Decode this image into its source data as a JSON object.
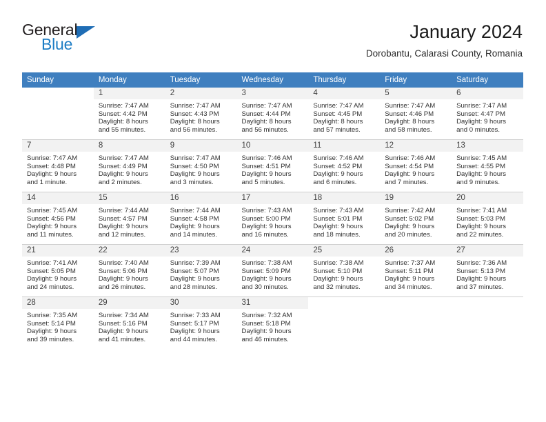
{
  "brand": {
    "name_part1": "General",
    "name_part2": "Blue",
    "logo_icon": "triangle-logo-icon"
  },
  "header": {
    "month_title": "January 2024",
    "location": "Dorobantu, Calarasi County, Romania"
  },
  "colors": {
    "header_blue": "#3f7fbf",
    "brand_blue": "#1c7cc4",
    "daynum_bg": "#f2f2f2",
    "grid_line": "#cfcfcf"
  },
  "weekday_headers": [
    "Sunday",
    "Monday",
    "Tuesday",
    "Wednesday",
    "Thursday",
    "Friday",
    "Saturday"
  ],
  "weeks": [
    [
      {
        "day": "",
        "blank": true,
        "sunrise": "",
        "sunset": "",
        "daylight_line1": "",
        "daylight_line2": ""
      },
      {
        "day": "1",
        "sunrise": "Sunrise: 7:47 AM",
        "sunset": "Sunset: 4:42 PM",
        "daylight_line1": "Daylight: 8 hours",
        "daylight_line2": "and 55 minutes."
      },
      {
        "day": "2",
        "sunrise": "Sunrise: 7:47 AM",
        "sunset": "Sunset: 4:43 PM",
        "daylight_line1": "Daylight: 8 hours",
        "daylight_line2": "and 56 minutes."
      },
      {
        "day": "3",
        "sunrise": "Sunrise: 7:47 AM",
        "sunset": "Sunset: 4:44 PM",
        "daylight_line1": "Daylight: 8 hours",
        "daylight_line2": "and 56 minutes."
      },
      {
        "day": "4",
        "sunrise": "Sunrise: 7:47 AM",
        "sunset": "Sunset: 4:45 PM",
        "daylight_line1": "Daylight: 8 hours",
        "daylight_line2": "and 57 minutes."
      },
      {
        "day": "5",
        "sunrise": "Sunrise: 7:47 AM",
        "sunset": "Sunset: 4:46 PM",
        "daylight_line1": "Daylight: 8 hours",
        "daylight_line2": "and 58 minutes."
      },
      {
        "day": "6",
        "sunrise": "Sunrise: 7:47 AM",
        "sunset": "Sunset: 4:47 PM",
        "daylight_line1": "Daylight: 9 hours",
        "daylight_line2": "and 0 minutes."
      }
    ],
    [
      {
        "day": "7",
        "sunrise": "Sunrise: 7:47 AM",
        "sunset": "Sunset: 4:48 PM",
        "daylight_line1": "Daylight: 9 hours",
        "daylight_line2": "and 1 minute."
      },
      {
        "day": "8",
        "sunrise": "Sunrise: 7:47 AM",
        "sunset": "Sunset: 4:49 PM",
        "daylight_line1": "Daylight: 9 hours",
        "daylight_line2": "and 2 minutes."
      },
      {
        "day": "9",
        "sunrise": "Sunrise: 7:47 AM",
        "sunset": "Sunset: 4:50 PM",
        "daylight_line1": "Daylight: 9 hours",
        "daylight_line2": "and 3 minutes."
      },
      {
        "day": "10",
        "sunrise": "Sunrise: 7:46 AM",
        "sunset": "Sunset: 4:51 PM",
        "daylight_line1": "Daylight: 9 hours",
        "daylight_line2": "and 5 minutes."
      },
      {
        "day": "11",
        "sunrise": "Sunrise: 7:46 AM",
        "sunset": "Sunset: 4:52 PM",
        "daylight_line1": "Daylight: 9 hours",
        "daylight_line2": "and 6 minutes."
      },
      {
        "day": "12",
        "sunrise": "Sunrise: 7:46 AM",
        "sunset": "Sunset: 4:54 PM",
        "daylight_line1": "Daylight: 9 hours",
        "daylight_line2": "and 7 minutes."
      },
      {
        "day": "13",
        "sunrise": "Sunrise: 7:45 AM",
        "sunset": "Sunset: 4:55 PM",
        "daylight_line1": "Daylight: 9 hours",
        "daylight_line2": "and 9 minutes."
      }
    ],
    [
      {
        "day": "14",
        "sunrise": "Sunrise: 7:45 AM",
        "sunset": "Sunset: 4:56 PM",
        "daylight_line1": "Daylight: 9 hours",
        "daylight_line2": "and 11 minutes."
      },
      {
        "day": "15",
        "sunrise": "Sunrise: 7:44 AM",
        "sunset": "Sunset: 4:57 PM",
        "daylight_line1": "Daylight: 9 hours",
        "daylight_line2": "and 12 minutes."
      },
      {
        "day": "16",
        "sunrise": "Sunrise: 7:44 AM",
        "sunset": "Sunset: 4:58 PM",
        "daylight_line1": "Daylight: 9 hours",
        "daylight_line2": "and 14 minutes."
      },
      {
        "day": "17",
        "sunrise": "Sunrise: 7:43 AM",
        "sunset": "Sunset: 5:00 PM",
        "daylight_line1": "Daylight: 9 hours",
        "daylight_line2": "and 16 minutes."
      },
      {
        "day": "18",
        "sunrise": "Sunrise: 7:43 AM",
        "sunset": "Sunset: 5:01 PM",
        "daylight_line1": "Daylight: 9 hours",
        "daylight_line2": "and 18 minutes."
      },
      {
        "day": "19",
        "sunrise": "Sunrise: 7:42 AM",
        "sunset": "Sunset: 5:02 PM",
        "daylight_line1": "Daylight: 9 hours",
        "daylight_line2": "and 20 minutes."
      },
      {
        "day": "20",
        "sunrise": "Sunrise: 7:41 AM",
        "sunset": "Sunset: 5:03 PM",
        "daylight_line1": "Daylight: 9 hours",
        "daylight_line2": "and 22 minutes."
      }
    ],
    [
      {
        "day": "21",
        "sunrise": "Sunrise: 7:41 AM",
        "sunset": "Sunset: 5:05 PM",
        "daylight_line1": "Daylight: 9 hours",
        "daylight_line2": "and 24 minutes."
      },
      {
        "day": "22",
        "sunrise": "Sunrise: 7:40 AM",
        "sunset": "Sunset: 5:06 PM",
        "daylight_line1": "Daylight: 9 hours",
        "daylight_line2": "and 26 minutes."
      },
      {
        "day": "23",
        "sunrise": "Sunrise: 7:39 AM",
        "sunset": "Sunset: 5:07 PM",
        "daylight_line1": "Daylight: 9 hours",
        "daylight_line2": "and 28 minutes."
      },
      {
        "day": "24",
        "sunrise": "Sunrise: 7:38 AM",
        "sunset": "Sunset: 5:09 PM",
        "daylight_line1": "Daylight: 9 hours",
        "daylight_line2": "and 30 minutes."
      },
      {
        "day": "25",
        "sunrise": "Sunrise: 7:38 AM",
        "sunset": "Sunset: 5:10 PM",
        "daylight_line1": "Daylight: 9 hours",
        "daylight_line2": "and 32 minutes."
      },
      {
        "day": "26",
        "sunrise": "Sunrise: 7:37 AM",
        "sunset": "Sunset: 5:11 PM",
        "daylight_line1": "Daylight: 9 hours",
        "daylight_line2": "and 34 minutes."
      },
      {
        "day": "27",
        "sunrise": "Sunrise: 7:36 AM",
        "sunset": "Sunset: 5:13 PM",
        "daylight_line1": "Daylight: 9 hours",
        "daylight_line2": "and 37 minutes."
      }
    ],
    [
      {
        "day": "28",
        "sunrise": "Sunrise: 7:35 AM",
        "sunset": "Sunset: 5:14 PM",
        "daylight_line1": "Daylight: 9 hours",
        "daylight_line2": "and 39 minutes."
      },
      {
        "day": "29",
        "sunrise": "Sunrise: 7:34 AM",
        "sunset": "Sunset: 5:16 PM",
        "daylight_line1": "Daylight: 9 hours",
        "daylight_line2": "and 41 minutes."
      },
      {
        "day": "30",
        "sunrise": "Sunrise: 7:33 AM",
        "sunset": "Sunset: 5:17 PM",
        "daylight_line1": "Daylight: 9 hours",
        "daylight_line2": "and 44 minutes."
      },
      {
        "day": "31",
        "sunrise": "Sunrise: 7:32 AM",
        "sunset": "Sunset: 5:18 PM",
        "daylight_line1": "Daylight: 9 hours",
        "daylight_line2": "and 46 minutes."
      },
      {
        "day": "",
        "blank": true,
        "sunrise": "",
        "sunset": "",
        "daylight_line1": "",
        "daylight_line2": ""
      },
      {
        "day": "",
        "blank": true,
        "sunrise": "",
        "sunset": "",
        "daylight_line1": "",
        "daylight_line2": ""
      },
      {
        "day": "",
        "blank": true,
        "sunrise": "",
        "sunset": "",
        "daylight_line1": "",
        "daylight_line2": ""
      }
    ]
  ]
}
